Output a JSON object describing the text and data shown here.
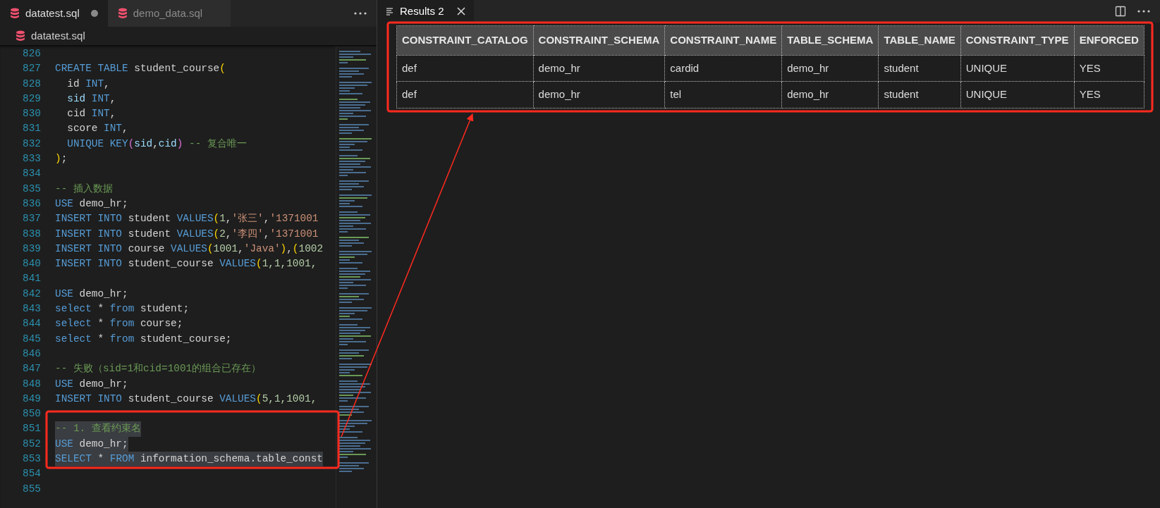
{
  "editor": {
    "tabs": [
      {
        "label": "datatest.sql",
        "selected": true,
        "dirty": true
      },
      {
        "label": "demo_data.sql",
        "selected": false,
        "dirty": false
      }
    ],
    "breadcrumb": "datatest.sql",
    "lines": [
      {
        "number": "826",
        "selected": false
      },
      {
        "number": "827",
        "selected": false,
        "tokens": [
          {
            "kind": "keyword",
            "text": "CREATE TABLE"
          },
          {
            "kind": "text",
            "text": " student_course"
          },
          {
            "kind": "paren",
            "text": "("
          }
        ]
      },
      {
        "number": "828",
        "selected": false,
        "tokens": [
          {
            "kind": "text",
            "text": "  id "
          },
          {
            "kind": "keyword",
            "text": "INT"
          },
          {
            "kind": "text",
            "text": ","
          }
        ]
      },
      {
        "number": "829",
        "selected": false,
        "tokens": [
          {
            "kind": "variable",
            "text": "  sid "
          },
          {
            "kind": "keyword",
            "text": "INT"
          },
          {
            "kind": "text",
            "text": ","
          }
        ]
      },
      {
        "number": "830",
        "selected": false,
        "tokens": [
          {
            "kind": "text",
            "text": "  cid "
          },
          {
            "kind": "keyword",
            "text": "INT"
          },
          {
            "kind": "text",
            "text": ","
          }
        ]
      },
      {
        "number": "831",
        "selected": false,
        "tokens": [
          {
            "kind": "text",
            "text": "  score "
          },
          {
            "kind": "keyword",
            "text": "INT"
          },
          {
            "kind": "text",
            "text": ","
          }
        ]
      },
      {
        "number": "832",
        "selected": false,
        "tokens": [
          {
            "kind": "keyword",
            "text": "  UNIQUE KEY"
          },
          {
            "kind": "paren2",
            "text": "("
          },
          {
            "kind": "variable",
            "text": "sid"
          },
          {
            "kind": "text",
            "text": ","
          },
          {
            "kind": "variable",
            "text": "cid"
          },
          {
            "kind": "paren2",
            "text": ")"
          },
          {
            "kind": "comment",
            "text": " -- 复合唯一"
          }
        ]
      },
      {
        "number": "833",
        "selected": false,
        "tokens": [
          {
            "kind": "paren",
            "text": ")"
          },
          {
            "kind": "text",
            "text": ";"
          }
        ]
      },
      {
        "number": "834",
        "selected": false
      },
      {
        "number": "835",
        "selected": false,
        "tokens": [
          {
            "kind": "comment",
            "text": "-- 插入数据"
          }
        ]
      },
      {
        "number": "836",
        "selected": false,
        "tokens": [
          {
            "kind": "keyword",
            "text": "USE"
          },
          {
            "kind": "text",
            "text": " demo_hr;"
          }
        ]
      },
      {
        "number": "837",
        "selected": false,
        "tokens": [
          {
            "kind": "keyword",
            "text": "INSERT INTO"
          },
          {
            "kind": "text",
            "text": " student "
          },
          {
            "kind": "keyword",
            "text": "VALUES"
          },
          {
            "kind": "paren",
            "text": "("
          },
          {
            "kind": "number",
            "text": "1"
          },
          {
            "kind": "text",
            "text": ","
          },
          {
            "kind": "string",
            "text": "'张三'"
          },
          {
            "kind": "text",
            "text": ","
          },
          {
            "kind": "string",
            "text": "'1371001"
          }
        ]
      },
      {
        "number": "838",
        "selected": false,
        "tokens": [
          {
            "kind": "keyword",
            "text": "INSERT INTO"
          },
          {
            "kind": "text",
            "text": " student "
          },
          {
            "kind": "keyword",
            "text": "VALUES"
          },
          {
            "kind": "paren",
            "text": "("
          },
          {
            "kind": "number",
            "text": "2"
          },
          {
            "kind": "text",
            "text": ","
          },
          {
            "kind": "string",
            "text": "'李四'"
          },
          {
            "kind": "text",
            "text": ","
          },
          {
            "kind": "string",
            "text": "'1371001"
          }
        ]
      },
      {
        "number": "839",
        "selected": false,
        "tokens": [
          {
            "kind": "keyword",
            "text": "INSERT INTO"
          },
          {
            "kind": "text",
            "text": " course "
          },
          {
            "kind": "keyword",
            "text": "VALUES"
          },
          {
            "kind": "paren",
            "text": "("
          },
          {
            "kind": "number",
            "text": "1001"
          },
          {
            "kind": "text",
            "text": ","
          },
          {
            "kind": "string",
            "text": "'Java'"
          },
          {
            "kind": "paren",
            "text": ")"
          },
          {
            "kind": "text",
            "text": ","
          },
          {
            "kind": "paren",
            "text": "("
          },
          {
            "kind": "number",
            "text": "1002"
          }
        ]
      },
      {
        "number": "840",
        "selected": false,
        "tokens": [
          {
            "kind": "keyword",
            "text": "INSERT INTO"
          },
          {
            "kind": "text",
            "text": " student_course "
          },
          {
            "kind": "keyword",
            "text": "VALUES"
          },
          {
            "kind": "paren",
            "text": "("
          },
          {
            "kind": "number",
            "text": "1,1,1001,"
          }
        ]
      },
      {
        "number": "841",
        "selected": false
      },
      {
        "number": "842",
        "selected": false,
        "tokens": [
          {
            "kind": "keyword",
            "text": "USE"
          },
          {
            "kind": "text",
            "text": " demo_hr;"
          }
        ]
      },
      {
        "number": "843",
        "selected": false,
        "tokens": [
          {
            "kind": "keyword",
            "text": "select"
          },
          {
            "kind": "text",
            "text": " * "
          },
          {
            "kind": "keyword",
            "text": "from"
          },
          {
            "kind": "text",
            "text": " student;"
          }
        ]
      },
      {
        "number": "844",
        "selected": false,
        "tokens": [
          {
            "kind": "keyword",
            "text": "select"
          },
          {
            "kind": "text",
            "text": " * "
          },
          {
            "kind": "keyword",
            "text": "from"
          },
          {
            "kind": "text",
            "text": " course;"
          }
        ]
      },
      {
        "number": "845",
        "selected": false,
        "tokens": [
          {
            "kind": "keyword",
            "text": "select"
          },
          {
            "kind": "text",
            "text": " * "
          },
          {
            "kind": "keyword",
            "text": "from"
          },
          {
            "kind": "text",
            "text": " student_course;"
          }
        ]
      },
      {
        "number": "846",
        "selected": false
      },
      {
        "number": "847",
        "selected": false,
        "tokens": [
          {
            "kind": "comment",
            "text": "-- 失败（sid=1和cid=1001的组合已存在）"
          }
        ]
      },
      {
        "number": "848",
        "selected": false,
        "tokens": [
          {
            "kind": "keyword",
            "text": "USE"
          },
          {
            "kind": "text",
            "text": " demo_hr;"
          }
        ]
      },
      {
        "number": "849",
        "selected": false,
        "tokens": [
          {
            "kind": "keyword",
            "text": "INSERT INTO"
          },
          {
            "kind": "text",
            "text": " student_course "
          },
          {
            "kind": "keyword",
            "text": "VALUES"
          },
          {
            "kind": "paren",
            "text": "("
          },
          {
            "kind": "number",
            "text": "5,1,1001,"
          }
        ]
      },
      {
        "number": "850",
        "selected": false
      },
      {
        "number": "851",
        "selected": true,
        "tokens": [
          {
            "kind": "comment",
            "text": "-- 1. 查看约束名"
          }
        ]
      },
      {
        "number": "852",
        "selected": true,
        "tokens": [
          {
            "kind": "keyword",
            "text": "USE"
          },
          {
            "kind": "text",
            "text": " demo_hr;"
          }
        ]
      },
      {
        "number": "853",
        "selected": true,
        "tokens": [
          {
            "kind": "keyword",
            "text": "SELECT"
          },
          {
            "kind": "text",
            "text": " * "
          },
          {
            "kind": "keyword",
            "text": "FROM"
          },
          {
            "kind": "text",
            "text": " information_schema.table_const"
          }
        ]
      },
      {
        "number": "854",
        "selected": false
      },
      {
        "number": "855",
        "selected": false
      }
    ]
  },
  "results": {
    "tab": {
      "label": "Results 2",
      "selected": true
    },
    "table": {
      "columns": [
        "CONSTRAINT_CATALOG",
        "CONSTRAINT_SCHEMA",
        "CONSTRAINT_NAME",
        "TABLE_SCHEMA",
        "TABLE_NAME",
        "CONSTRAINT_TYPE",
        "ENFORCED"
      ],
      "rows": [
        [
          "def",
          "demo_hr",
          "cardid",
          "demo_hr",
          "student",
          "UNIQUE",
          "YES"
        ],
        [
          "def",
          "demo_hr",
          "tel",
          "demo_hr",
          "student",
          "UNIQUE",
          "YES"
        ]
      ]
    }
  }
}
